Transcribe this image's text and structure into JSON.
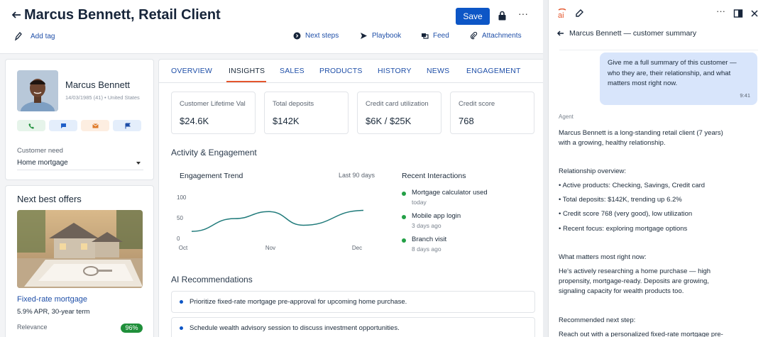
{
  "header": {
    "title": "Marcus Bennett, Retail Client",
    "save_label": "Save",
    "add_tag_label": "Add tag",
    "actions": [
      {
        "label": "Next steps",
        "icon": "next-steps-icon"
      },
      {
        "label": "Playbook",
        "icon": "send-icon"
      },
      {
        "label": "Feed",
        "icon": "feed-icon"
      },
      {
        "label": "Attachments",
        "icon": "paperclip-icon"
      }
    ]
  },
  "profile": {
    "name": "Marcus Bennett",
    "meta": "14/03/1985 (41) • United States",
    "contact_buttons": [
      {
        "icon": "phone-icon",
        "bg": "#e6f4ea",
        "color": "#1f8f3a"
      },
      {
        "icon": "chat-icon",
        "bg": "#e4eefb",
        "color": "#1f5fc8"
      },
      {
        "icon": "email-icon",
        "bg": "#fdeee1",
        "color": "#e07b2a"
      },
      {
        "icon": "flag-icon",
        "bg": "#e4eefb",
        "color": "#1f4fa8"
      }
    ],
    "need_label": "Customer need",
    "need_value": "Home mortgage"
  },
  "offers": {
    "title": "Next best offers",
    "offer_name": "Fixed-rate mortgage",
    "offer_terms": "5.9% APR, 30-year term",
    "relevance_label": "Relevance",
    "relevance_value": "96%"
  },
  "tabs": [
    "OVERVIEW",
    "INSIGHTS",
    "SALES",
    "PRODUCTS",
    "HISTORY",
    "NEWS",
    "ENGAGEMENT"
  ],
  "active_tab": "INSIGHTS",
  "metrics": [
    {
      "label": "Customer Lifetime Val",
      "value": "$24.6K"
    },
    {
      "label": "Total deposits",
      "value": "$142K"
    },
    {
      "label": "Credit card utilization",
      "value": "$6K / $25K"
    },
    {
      "label": "Credit score",
      "value": "768"
    }
  ],
  "activity": {
    "title": "Activity & Engagement",
    "trend_title": "Engagement Trend",
    "trend_range": "Last 90 days",
    "recent_title": "Recent Interactions",
    "interactions": [
      {
        "title": "Mortgage calculator used",
        "when": "today"
      },
      {
        "title": "Mobile app login",
        "when": "3 days ago"
      },
      {
        "title": "Branch visit",
        "when": "8 days ago"
      }
    ]
  },
  "chart_data": {
    "type": "line",
    "title": "Engagement Trend",
    "x_tick_labels": [
      "Oct",
      "Nov",
      "Dec"
    ],
    "y_tick_labels": [
      "100",
      "50",
      "0"
    ],
    "ylim": [
      0,
      100
    ],
    "series": [
      {
        "color": "#1f7a7a",
        "x": [
          0,
          0.25,
          0.45,
          0.65,
          1.0
        ],
        "y": [
          17,
          48,
          65,
          32,
          68
        ]
      }
    ]
  },
  "recommendations": {
    "title": "AI Recommendations",
    "items": [
      "Prioritize fixed-rate mortgage pre-approval for upcoming home purchase.",
      "Schedule wealth advisory session to discuss investment opportunities."
    ]
  },
  "panel": {
    "title": "Marcus Bennett — customer summary",
    "user_message": "Give me a full summary of this customer — who they are, their relationship, and what matters most right now.",
    "user_time": "9:41",
    "agent_label": "Agent",
    "agent_lines": [
      "Marcus Bennett is a long-standing retail client (7 years)",
      "with a growing, healthy relationship.",
      "Relationship overview:",
      "• Active products: Checking, Savings, Credit card",
      "• Total deposits: $142K, trending up 6.2%",
      "• Credit score 768 (very good), low utilization",
      "• Recent focus: exploring mortgage options",
      "What matters most right now:",
      "He's actively researching a home purchase — high",
      "propensity, mortgage-ready. Deposits are growing,",
      "signaling capacity for wealth products too.",
      "Recommended next step:",
      "Reach out with a personalized fixed-rate mortgage pre-"
    ]
  }
}
